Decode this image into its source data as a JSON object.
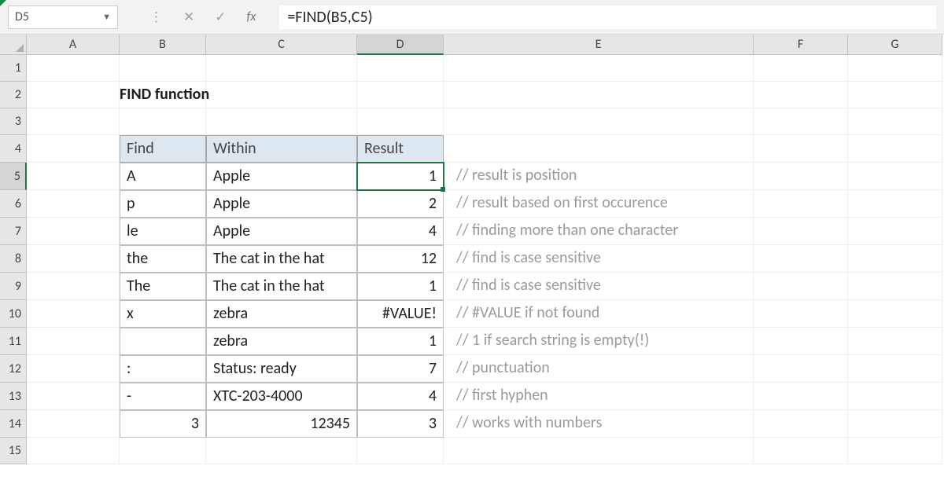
{
  "formula_bar": {
    "cell_ref": "D5",
    "formula": "=FIND(B5,C5)"
  },
  "columns": [
    "A",
    "B",
    "C",
    "D",
    "E",
    "F",
    "G"
  ],
  "rows": [
    1,
    2,
    3,
    4,
    5,
    6,
    7,
    8,
    9,
    10,
    11,
    12,
    13,
    14,
    15
  ],
  "active": {
    "row": 5,
    "col": "D"
  },
  "title": "FIND function",
  "headers": {
    "find": "Find",
    "within": "Within",
    "result": "Result"
  },
  "tbl": [
    {
      "find": "A",
      "within": "Apple",
      "result": "1",
      "comment": "// result is position"
    },
    {
      "find": "p",
      "within": "Apple",
      "result": "2",
      "comment": "// result based on first occurence"
    },
    {
      "find": "le",
      "within": "Apple",
      "result": "4",
      "comment": "// finding more than one character"
    },
    {
      "find": "the",
      "within": "The cat in the hat",
      "result": "12",
      "comment": "// find is case sensitive"
    },
    {
      "find": "The",
      "within": "The cat in the hat",
      "result": "1",
      "comment": "// find is case sensitive"
    },
    {
      "find": "x",
      "within": "zebra",
      "result": "#VALUE!",
      "comment": "// #VALUE if not found"
    },
    {
      "find": "",
      "within": "zebra",
      "result": "1",
      "comment": "// 1 if search string is empty(!)"
    },
    {
      "find": ":",
      "within": "Status: ready",
      "result": "7",
      "comment": "// punctuation"
    },
    {
      "find": "-",
      "within": "XTC-203-4000",
      "result": "4",
      "comment": "// first hyphen"
    },
    {
      "find": "3",
      "within": "12345",
      "result": "3",
      "comment": "// works with numbers",
      "find_num": true,
      "within_num": true
    }
  ]
}
